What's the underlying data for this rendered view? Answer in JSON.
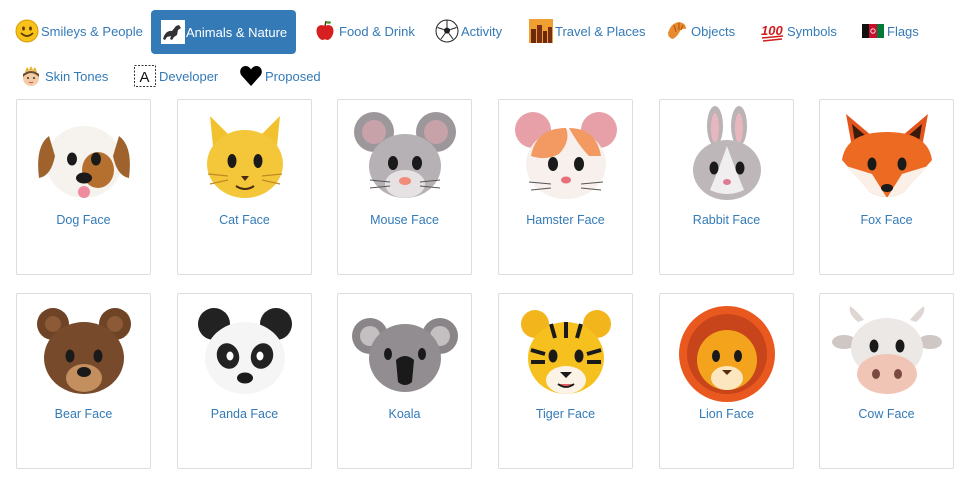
{
  "tabs": [
    {
      "label": "Smileys & People",
      "icon": "smiley-face-icon",
      "active": false
    },
    {
      "label": "Animals & Nature",
      "icon": "horse-icon",
      "active": true
    },
    {
      "label": "Food & Drink",
      "icon": "apple-icon",
      "active": false
    },
    {
      "label": "Activity",
      "icon": "soccer-ball-icon",
      "active": false
    },
    {
      "label": "Travel & Places",
      "icon": "city-skyline-icon",
      "active": false
    },
    {
      "label": "Objects",
      "icon": "croissant-icon",
      "active": false
    },
    {
      "label": "Symbols",
      "icon": "hundred-points-icon",
      "active": false
    },
    {
      "label": "Flags",
      "icon": "flag-icon",
      "active": false
    },
    {
      "label": "Skin Tones",
      "icon": "princess-icon",
      "active": false
    },
    {
      "label": "Developer",
      "icon": "letter-a-box-icon",
      "active": false
    },
    {
      "label": "Proposed",
      "icon": "black-heart-icon",
      "active": false
    }
  ],
  "accent": "#337ab7",
  "emojis": [
    {
      "name": "Dog Face",
      "icon": "dog-face-icon"
    },
    {
      "name": "Cat Face",
      "icon": "cat-face-icon"
    },
    {
      "name": "Mouse Face",
      "icon": "mouse-face-icon"
    },
    {
      "name": "Hamster Face",
      "icon": "hamster-face-icon"
    },
    {
      "name": "Rabbit Face",
      "icon": "rabbit-face-icon"
    },
    {
      "name": "Fox Face",
      "icon": "fox-face-icon"
    },
    {
      "name": "Bear Face",
      "icon": "bear-face-icon"
    },
    {
      "name": "Panda Face",
      "icon": "panda-face-icon"
    },
    {
      "name": "Koala",
      "icon": "koala-icon"
    },
    {
      "name": "Tiger Face",
      "icon": "tiger-face-icon"
    },
    {
      "name": "Lion Face",
      "icon": "lion-face-icon"
    },
    {
      "name": "Cow Face",
      "icon": "cow-face-icon"
    }
  ]
}
